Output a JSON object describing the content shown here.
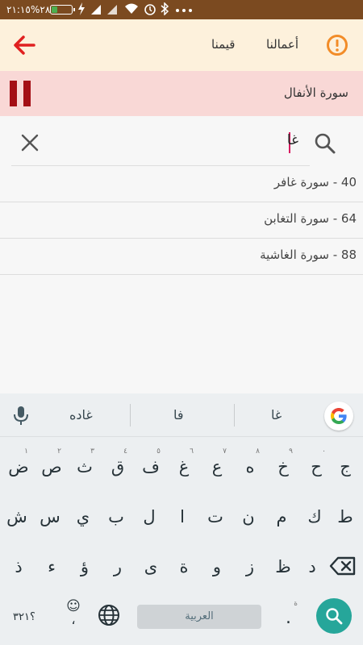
{
  "status_bar": {
    "time": "٢١:١٥",
    "battery": "%٢٨",
    "battery_level": 0.28,
    "icons": [
      "charging-icon",
      "signal-icon",
      "signal-icon",
      "wifi-icon",
      "alarm-icon",
      "bluetooth-icon",
      "more-dots-icon"
    ]
  },
  "app_bar": {
    "menu_works": "أعمالنا",
    "menu_values": "قيمنا",
    "back_icon": "arrow-left-icon",
    "alert_icon": "exclamation-circle-icon",
    "back_color": "#e02020",
    "alert_color": "#f28c28"
  },
  "now_playing": {
    "surah": "سورة الأنفال",
    "pause_icon": "pause-icon",
    "pause_color": "#a40f15"
  },
  "search": {
    "value": "غا",
    "clear_icon": "close-icon",
    "search_icon": "search-icon"
  },
  "results": [
    {
      "label": "40 - سورة غافر"
    },
    {
      "label": "64 - سورة التغابن"
    },
    {
      "label": "88 - سورة الغاشية"
    }
  ],
  "keyboard": {
    "suggestions": [
      "غا",
      "فا",
      "غاده"
    ],
    "row1": [
      {
        "ch": "ض",
        "hint": "١"
      },
      {
        "ch": "ص",
        "hint": "٢"
      },
      {
        "ch": "ث",
        "hint": "٣"
      },
      {
        "ch": "ق",
        "hint": "٤"
      },
      {
        "ch": "ف",
        "hint": "٥"
      },
      {
        "ch": "غ",
        "hint": "٦"
      },
      {
        "ch": "ع",
        "hint": "٧"
      },
      {
        "ch": "ه",
        "hint": "٨"
      },
      {
        "ch": "خ",
        "hint": "٩"
      },
      {
        "ch": "ح",
        "hint": "٠"
      },
      {
        "ch": "ج",
        "hint": ""
      }
    ],
    "row2": [
      "ش",
      "س",
      "ي",
      "ب",
      "ل",
      "ا",
      "ت",
      "ن",
      "م",
      "ك",
      "ط"
    ],
    "row3": [
      "ذ",
      "ء",
      "ؤ",
      "ر",
      "ى",
      "ة",
      "و",
      "ز",
      "ظ",
      "د"
    ],
    "symbols": "؟٣٢١",
    "emoji_comma": "،",
    "space_label": "العربية",
    "period": ".",
    "period_hint": "ة",
    "accent": "#26a69a"
  }
}
